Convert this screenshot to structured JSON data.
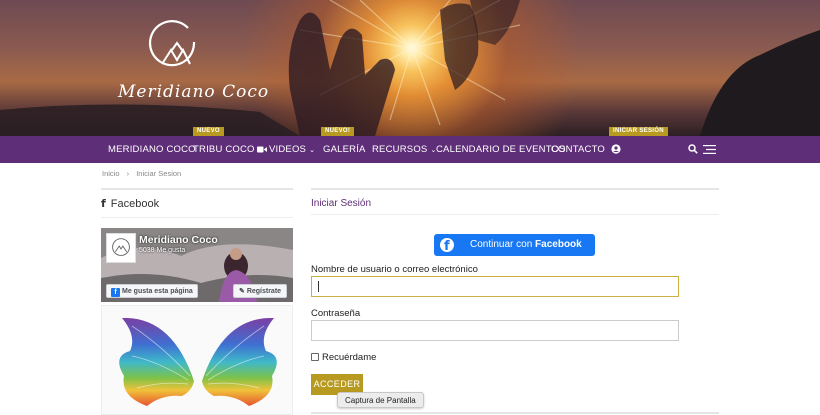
{
  "brand": {
    "name": "Meridiano Coco"
  },
  "nav": {
    "items": [
      {
        "label": "MERIDIANO COCO"
      },
      {
        "label": "TRIBU COCO",
        "badge": "NUEVO"
      },
      {
        "label": "VIDEOS",
        "icon": "video-icon",
        "dropdown": true
      },
      {
        "label": "GALERÍA",
        "badge": "NUEVO!"
      },
      {
        "label": "RECURSOS",
        "dropdown": true
      },
      {
        "label": "CALENDARIO DE EVENTOS"
      },
      {
        "label": "CONTACTO"
      }
    ],
    "user_badge": "INICIAR SESIÓN",
    "user_icon": "user-circle-icon",
    "search_icon": "search-icon",
    "menu_icon": "hamburger-menu-icon",
    "bar_color": "#5f2e78",
    "accent_color": "#b89a20"
  },
  "breadcrumb": {
    "home": "Inicio",
    "separator": "›",
    "current": "Iniciar Sesion"
  },
  "sidebar": {
    "title": "Facebook",
    "fb_widget": {
      "page_name": "Meridiano Coco",
      "likes": "5038 Me gusta",
      "like_button": "Me gusta esta página",
      "register_button": "Regístrate"
    }
  },
  "login": {
    "title": "Iniciar Sesión",
    "facebook_button": {
      "prefix": "Continuar con ",
      "brand": "Facebook"
    },
    "username_label": "Nombre de usuario o correo electrónico",
    "username_value": "",
    "password_label": "Contraseña",
    "password_value": "",
    "remember_label": "Recuérdame",
    "submit_label": "ACCEDER",
    "tooltip": "Captura de Pantalla"
  }
}
